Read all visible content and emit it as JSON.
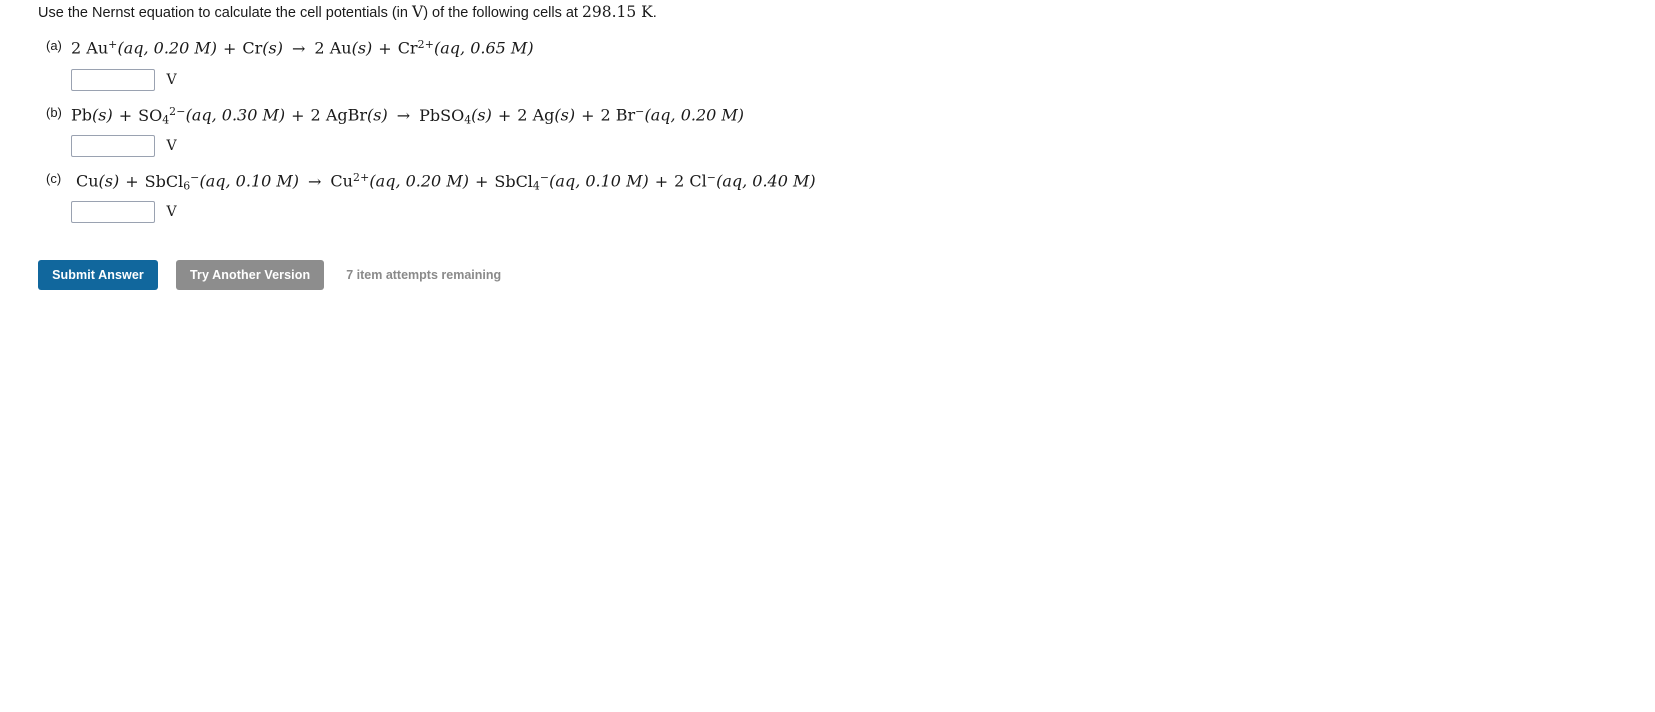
{
  "prompt": {
    "text_before": "Use the Nernst equation to calculate the cell potentials (in ",
    "unit_symbol": "V",
    "text_middle": ") of the following cells at ",
    "temperature": "298.15 K",
    "text_after": "."
  },
  "parts": [
    {
      "label": "(a)",
      "equation_plain": "2 Au+(aq, 0.20 M) + Cr(s) → 2 Au(s) + Cr2+(aq, 0.65 M)",
      "reactants": [
        {
          "coefficient": "2",
          "formula": "Au",
          "charge": "+",
          "state": "aq",
          "concentration": "0.20 M"
        },
        {
          "coefficient": "",
          "formula": "Cr",
          "charge": "",
          "state": "s",
          "concentration": ""
        }
      ],
      "products": [
        {
          "coefficient": "2",
          "formula": "Au",
          "charge": "",
          "state": "s",
          "concentration": ""
        },
        {
          "coefficient": "",
          "formula": "Cr",
          "charge": "2+",
          "state": "aq",
          "concentration": "0.65 M"
        }
      ],
      "answer_value": "",
      "answer_placeholder": "",
      "unit": "V"
    },
    {
      "label": "(b)",
      "equation_plain": "Pb(s) + SO4 2-(aq, 0.30 M) + 2 AgBr(s) → PbSO4(s) + 2 Ag(s) + 2 Br-(aq, 0.20 M)",
      "reactants": [
        {
          "coefficient": "",
          "formula": "Pb",
          "charge": "",
          "state": "s",
          "concentration": ""
        },
        {
          "coefficient": "",
          "formula": "SO4",
          "charge": "2−",
          "state": "aq",
          "concentration": "0.30 M"
        },
        {
          "coefficient": "2",
          "formula": "AgBr",
          "charge": "",
          "state": "s",
          "concentration": ""
        }
      ],
      "products": [
        {
          "coefficient": "",
          "formula": "PbSO4",
          "charge": "",
          "state": "s",
          "concentration": ""
        },
        {
          "coefficient": "2",
          "formula": "Ag",
          "charge": "",
          "state": "s",
          "concentration": ""
        },
        {
          "coefficient": "2",
          "formula": "Br",
          "charge": "−",
          "state": "aq",
          "concentration": "0.20 M"
        }
      ],
      "answer_value": "",
      "answer_placeholder": "",
      "unit": "V"
    },
    {
      "label": "(c)",
      "equation_plain": "Cu(s) + SbCl6-(aq, 0.10 M) → Cu2+(aq, 0.20 M) + SbCl4-(aq, 0.10 M) + 2 Cl-(aq, 0.40 M)",
      "reactants": [
        {
          "coefficient": "",
          "formula": "Cu",
          "charge": "",
          "state": "s",
          "concentration": ""
        },
        {
          "coefficient": "",
          "formula": "SbCl6",
          "charge": "−",
          "state": "aq",
          "concentration": "0.10 M"
        }
      ],
      "products": [
        {
          "coefficient": "",
          "formula": "Cu",
          "charge": "2+",
          "state": "aq",
          "concentration": "0.20 M"
        },
        {
          "coefficient": "",
          "formula": "SbCl4",
          "charge": "−",
          "state": "aq",
          "concentration": "0.10 M"
        },
        {
          "coefficient": "2",
          "formula": "Cl",
          "charge": "−",
          "state": "aq",
          "concentration": "0.40 M"
        }
      ],
      "answer_value": "",
      "answer_placeholder": "",
      "unit": "V"
    }
  ],
  "symbols": {
    "arrow": "→",
    "plus": "+"
  },
  "controls": {
    "submit_label": "Submit Answer",
    "try_another_label": "Try Another Version",
    "attempts_text": "7 item attempts remaining"
  },
  "colors": {
    "submit_button": "#11679d",
    "try_another_button": "#8d8d8d",
    "attempts_text": "#8a8a8a",
    "input_border": "#9aa2b1",
    "page_background": "#ffffff"
  }
}
